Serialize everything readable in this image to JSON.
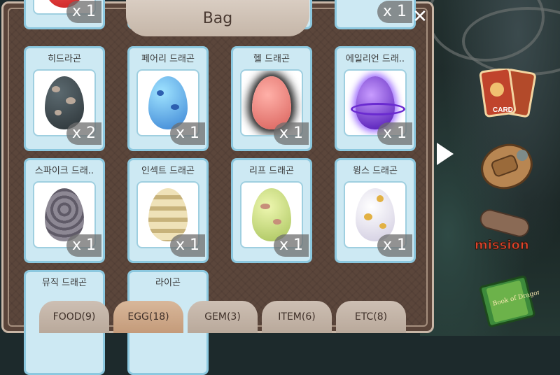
{
  "bag": {
    "title": "Bag",
    "close_label": "✕",
    "items": [
      {
        "name": "",
        "qty": "x 1"
      },
      {
        "name": "",
        "qty": ""
      },
      {
        "name": "",
        "qty": ""
      },
      {
        "name": "",
        "qty": "x 1"
      },
      {
        "name": "히드라곤",
        "qty": "x 2"
      },
      {
        "name": "페어리 드래곤",
        "qty": "x 1"
      },
      {
        "name": "헬 드래곤",
        "qty": "x 1"
      },
      {
        "name": "에일리언 드래..",
        "qty": "x 1"
      },
      {
        "name": "스파이크 드래..",
        "qty": "x 1"
      },
      {
        "name": "인섹트 드래곤",
        "qty": "x 1"
      },
      {
        "name": "리프 드래곤",
        "qty": "x 1"
      },
      {
        "name": "윙스 드래곤",
        "qty": "x 1"
      },
      {
        "name": "뮤직 드래곤",
        "qty": ""
      },
      {
        "name": "라이곤",
        "qty": ""
      }
    ],
    "tabs": [
      "FOOD(9)",
      "EGG(18)",
      "GEM(3)",
      "ITEM(6)",
      "ETC(8)"
    ],
    "active_tab": "EGG(18)"
  },
  "side_menu": {
    "card_label": "CARD",
    "mission_label": "mission",
    "book_label": "Book of Dragons"
  },
  "colors": {
    "panel": "#5b463b",
    "card": "#cde9f3",
    "card_border": "#8cc8df"
  }
}
